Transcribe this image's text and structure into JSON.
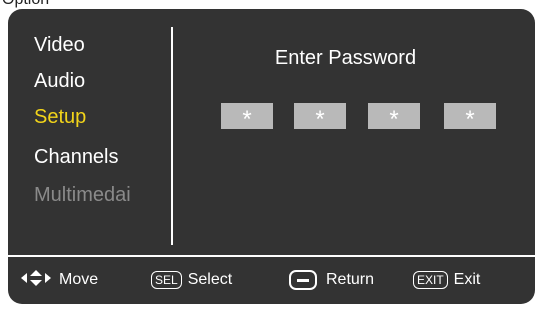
{
  "top_fragment": "Option",
  "menu": {
    "items": [
      {
        "label": "Video",
        "state": "normal"
      },
      {
        "label": "Audio",
        "state": "normal"
      },
      {
        "label": "Setup",
        "state": "selected"
      },
      {
        "label": "Channels",
        "state": "normal"
      },
      {
        "label": "Multimedai",
        "state": "disabled"
      }
    ]
  },
  "password": {
    "title": "Enter Password",
    "digits": [
      "*",
      "*",
      "*",
      "*"
    ]
  },
  "footer": {
    "move_label": "Move",
    "select_key": "SEL",
    "select_label": "Select",
    "return_label": "Return",
    "exit_key": "EXIT",
    "exit_label": "Exit"
  },
  "colors": {
    "osd_background": "#333333",
    "selected_text": "#f2d41a",
    "disabled_text": "#8a8a8a",
    "password_box": "#b9b9b9"
  }
}
